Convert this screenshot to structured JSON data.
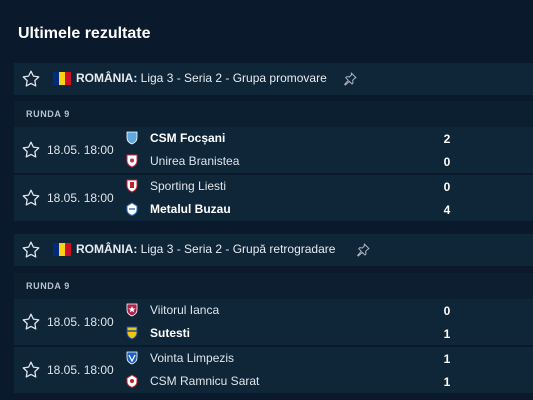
{
  "page_title": "Ultimele rezultate",
  "colors": {
    "background": "#0a1a2c",
    "row": "#0f2538",
    "flag_blue": "#002b7f",
    "flag_yellow": "#fcd116",
    "flag_red": "#ce1126"
  },
  "icons": {
    "favorite": "star-outline-icon",
    "pin": "pin-icon",
    "flag": "romania-flag-icon"
  },
  "leagues": [
    {
      "country": "ROMÂNIA:",
      "name": "Liga 3 - Seria 2 - Grupa promovare",
      "round": "RUNDA 9",
      "matches": [
        {
          "time": "18.05. 18:00",
          "home": {
            "name": "CSM Focșani",
            "winner": true,
            "score": "2"
          },
          "away": {
            "name": "Unirea Branistea",
            "winner": false,
            "score": "0"
          }
        },
        {
          "time": "18.05. 18:00",
          "home": {
            "name": "Sporting Liesti",
            "winner": false,
            "score": "0"
          },
          "away": {
            "name": "Metalul Buzau",
            "winner": true,
            "score": "4"
          }
        }
      ]
    },
    {
      "country": "ROMÂNIA:",
      "name": "Liga 3 - Seria 2 - Grupă retrogradare",
      "round": "RUNDA 9",
      "matches": [
        {
          "time": "18.05. 18:00",
          "home": {
            "name": "Viitorul Ianca",
            "winner": false,
            "score": "0"
          },
          "away": {
            "name": "Sutesti",
            "winner": true,
            "score": "1"
          }
        },
        {
          "time": "18.05. 18:00",
          "home": {
            "name": "Vointa Limpezis",
            "winner": false,
            "score": "1"
          },
          "away": {
            "name": "CSM Ramnicu Sarat",
            "winner": false,
            "score": "1"
          }
        }
      ]
    }
  ]
}
